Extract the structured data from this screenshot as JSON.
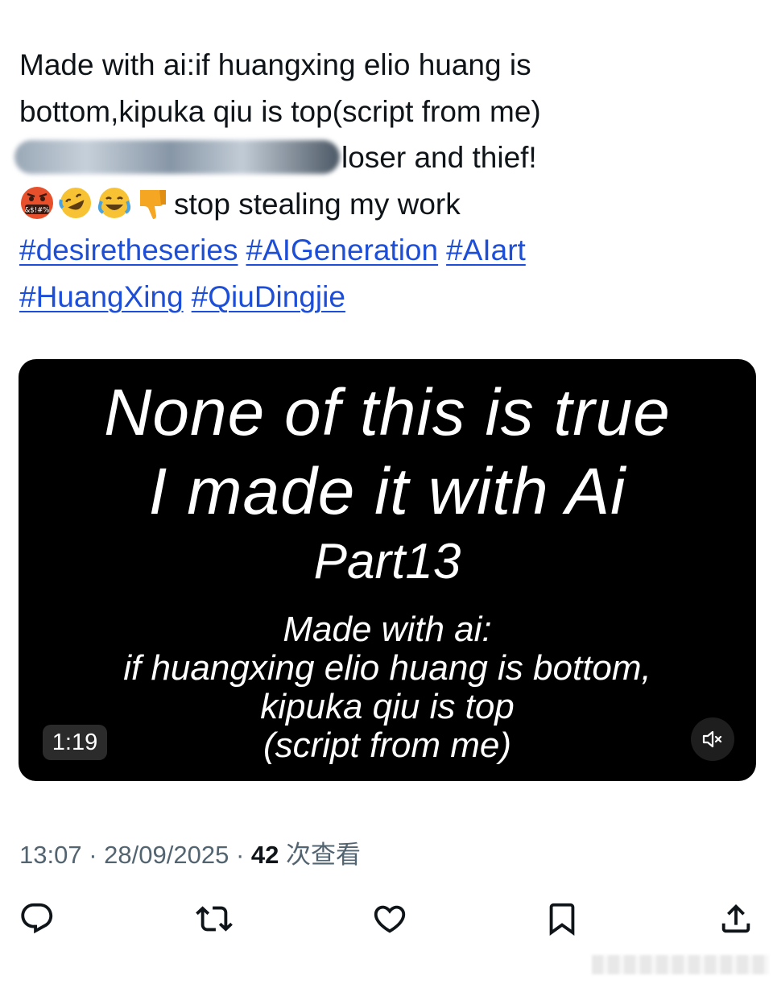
{
  "tweet": {
    "line1": "Made with ai:if huangxing elio huang is",
    "line2": "bottom,kipuka qiu is top(script from me)",
    "line3_visible": "loser and thief!",
    "line4": "stop stealing my work",
    "emojis": [
      "face-with-symbols-on-mouth",
      "rolling-on-floor-laughing",
      "face-with-tears-of-joy",
      "thumbs-down"
    ],
    "hashtags": [
      "#desiretheseries",
      "#AIGeneration",
      "#AIart",
      "#HuangXing",
      "#QiuDingjie"
    ],
    "hashtag_color": "#1d4ed8"
  },
  "video": {
    "title_line1": "None of this is true",
    "title_line2": "I made it with Ai",
    "part": "Part13",
    "sub_line1": "Made with ai:",
    "sub_line2": "if huangxing elio huang is bottom,",
    "sub_line3": "kipuka qiu is top",
    "sub_line4": "(script from me)",
    "duration": "1:19",
    "mute_icon": "speaker-muted-icon"
  },
  "meta": {
    "time": "13:07",
    "date": "28/09/2025",
    "views_count": "42",
    "views_label": "次查看",
    "separator": "·"
  },
  "actions": [
    "reply-icon",
    "retweet-icon",
    "like-icon",
    "bookmark-icon",
    "share-icon"
  ],
  "colors": {
    "text": "#0f1419",
    "muted": "#536471",
    "link": "#1d4ed8",
    "video_bg": "#000000"
  }
}
